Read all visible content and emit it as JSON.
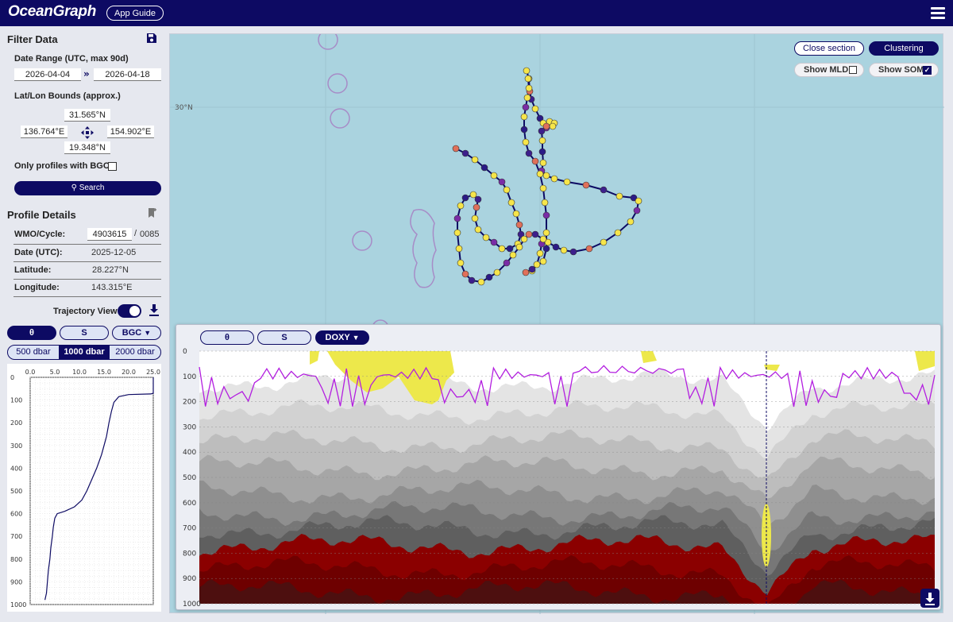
{
  "app": {
    "title": "OceanGraph",
    "guide_label": "App Guide",
    "menu_icon": "hamburger-menu-icon"
  },
  "filter": {
    "title": "Filter Data",
    "date_label": "Date Range (UTC, max 90d)",
    "date_start": "2026-04-04",
    "date_end": "2026-04-18",
    "bounds_label": "Lat/Lon Bounds (approx.)",
    "north": "31.565°N",
    "west": "136.764°E",
    "east": "154.902°E",
    "south": "19.348°N",
    "bgc_label": "Only profiles with BGC :",
    "search_label": "Search"
  },
  "profile": {
    "title": "Profile Details",
    "wmo_label": "WMO/Cycle:",
    "wmo": "4903615",
    "cycle_sep": "/",
    "cycle": "0085",
    "date_label": "Date (UTC):",
    "date": "2025-12-05",
    "lat_label": "Latitude:",
    "lat": "28.227°N",
    "lon_label": "Longitude:",
    "lon": "143.315°E",
    "trajectory_label": "Trajectory View"
  },
  "var_tabs": {
    "theta": "θ",
    "salinity": "S",
    "bgc": "BGC"
  },
  "depth_tabs": [
    "500 dbar",
    "1000 dbar",
    "2000 dbar"
  ],
  "profile_plot": {
    "x_ticks": [
      "0.0",
      "5.0",
      "10.0",
      "15.0",
      "20.0",
      "25.0"
    ],
    "y_ticks": [
      "0",
      "100",
      "200",
      "300",
      "400",
      "500",
      "600",
      "700",
      "800",
      "900",
      "1000"
    ]
  },
  "map": {
    "lat_label": "30°N",
    "close_section": "Close section",
    "clustering": "Clustering",
    "show_mld": "Show MLD",
    "show_som": "Show SOM"
  },
  "section": {
    "tabs": {
      "theta": "θ",
      "salinity": "S",
      "doxy": "DOXY"
    },
    "y_ticks": [
      "0",
      "100",
      "200",
      "300",
      "400",
      "500",
      "600",
      "700",
      "800",
      "900",
      "1000"
    ]
  },
  "colors": {
    "navy": "#0d0a63",
    "ocean": "#aad3df",
    "accent_yellow": "#ede84b",
    "accent_red": "#8b0000",
    "line_magenta": "#b31ee0"
  }
}
